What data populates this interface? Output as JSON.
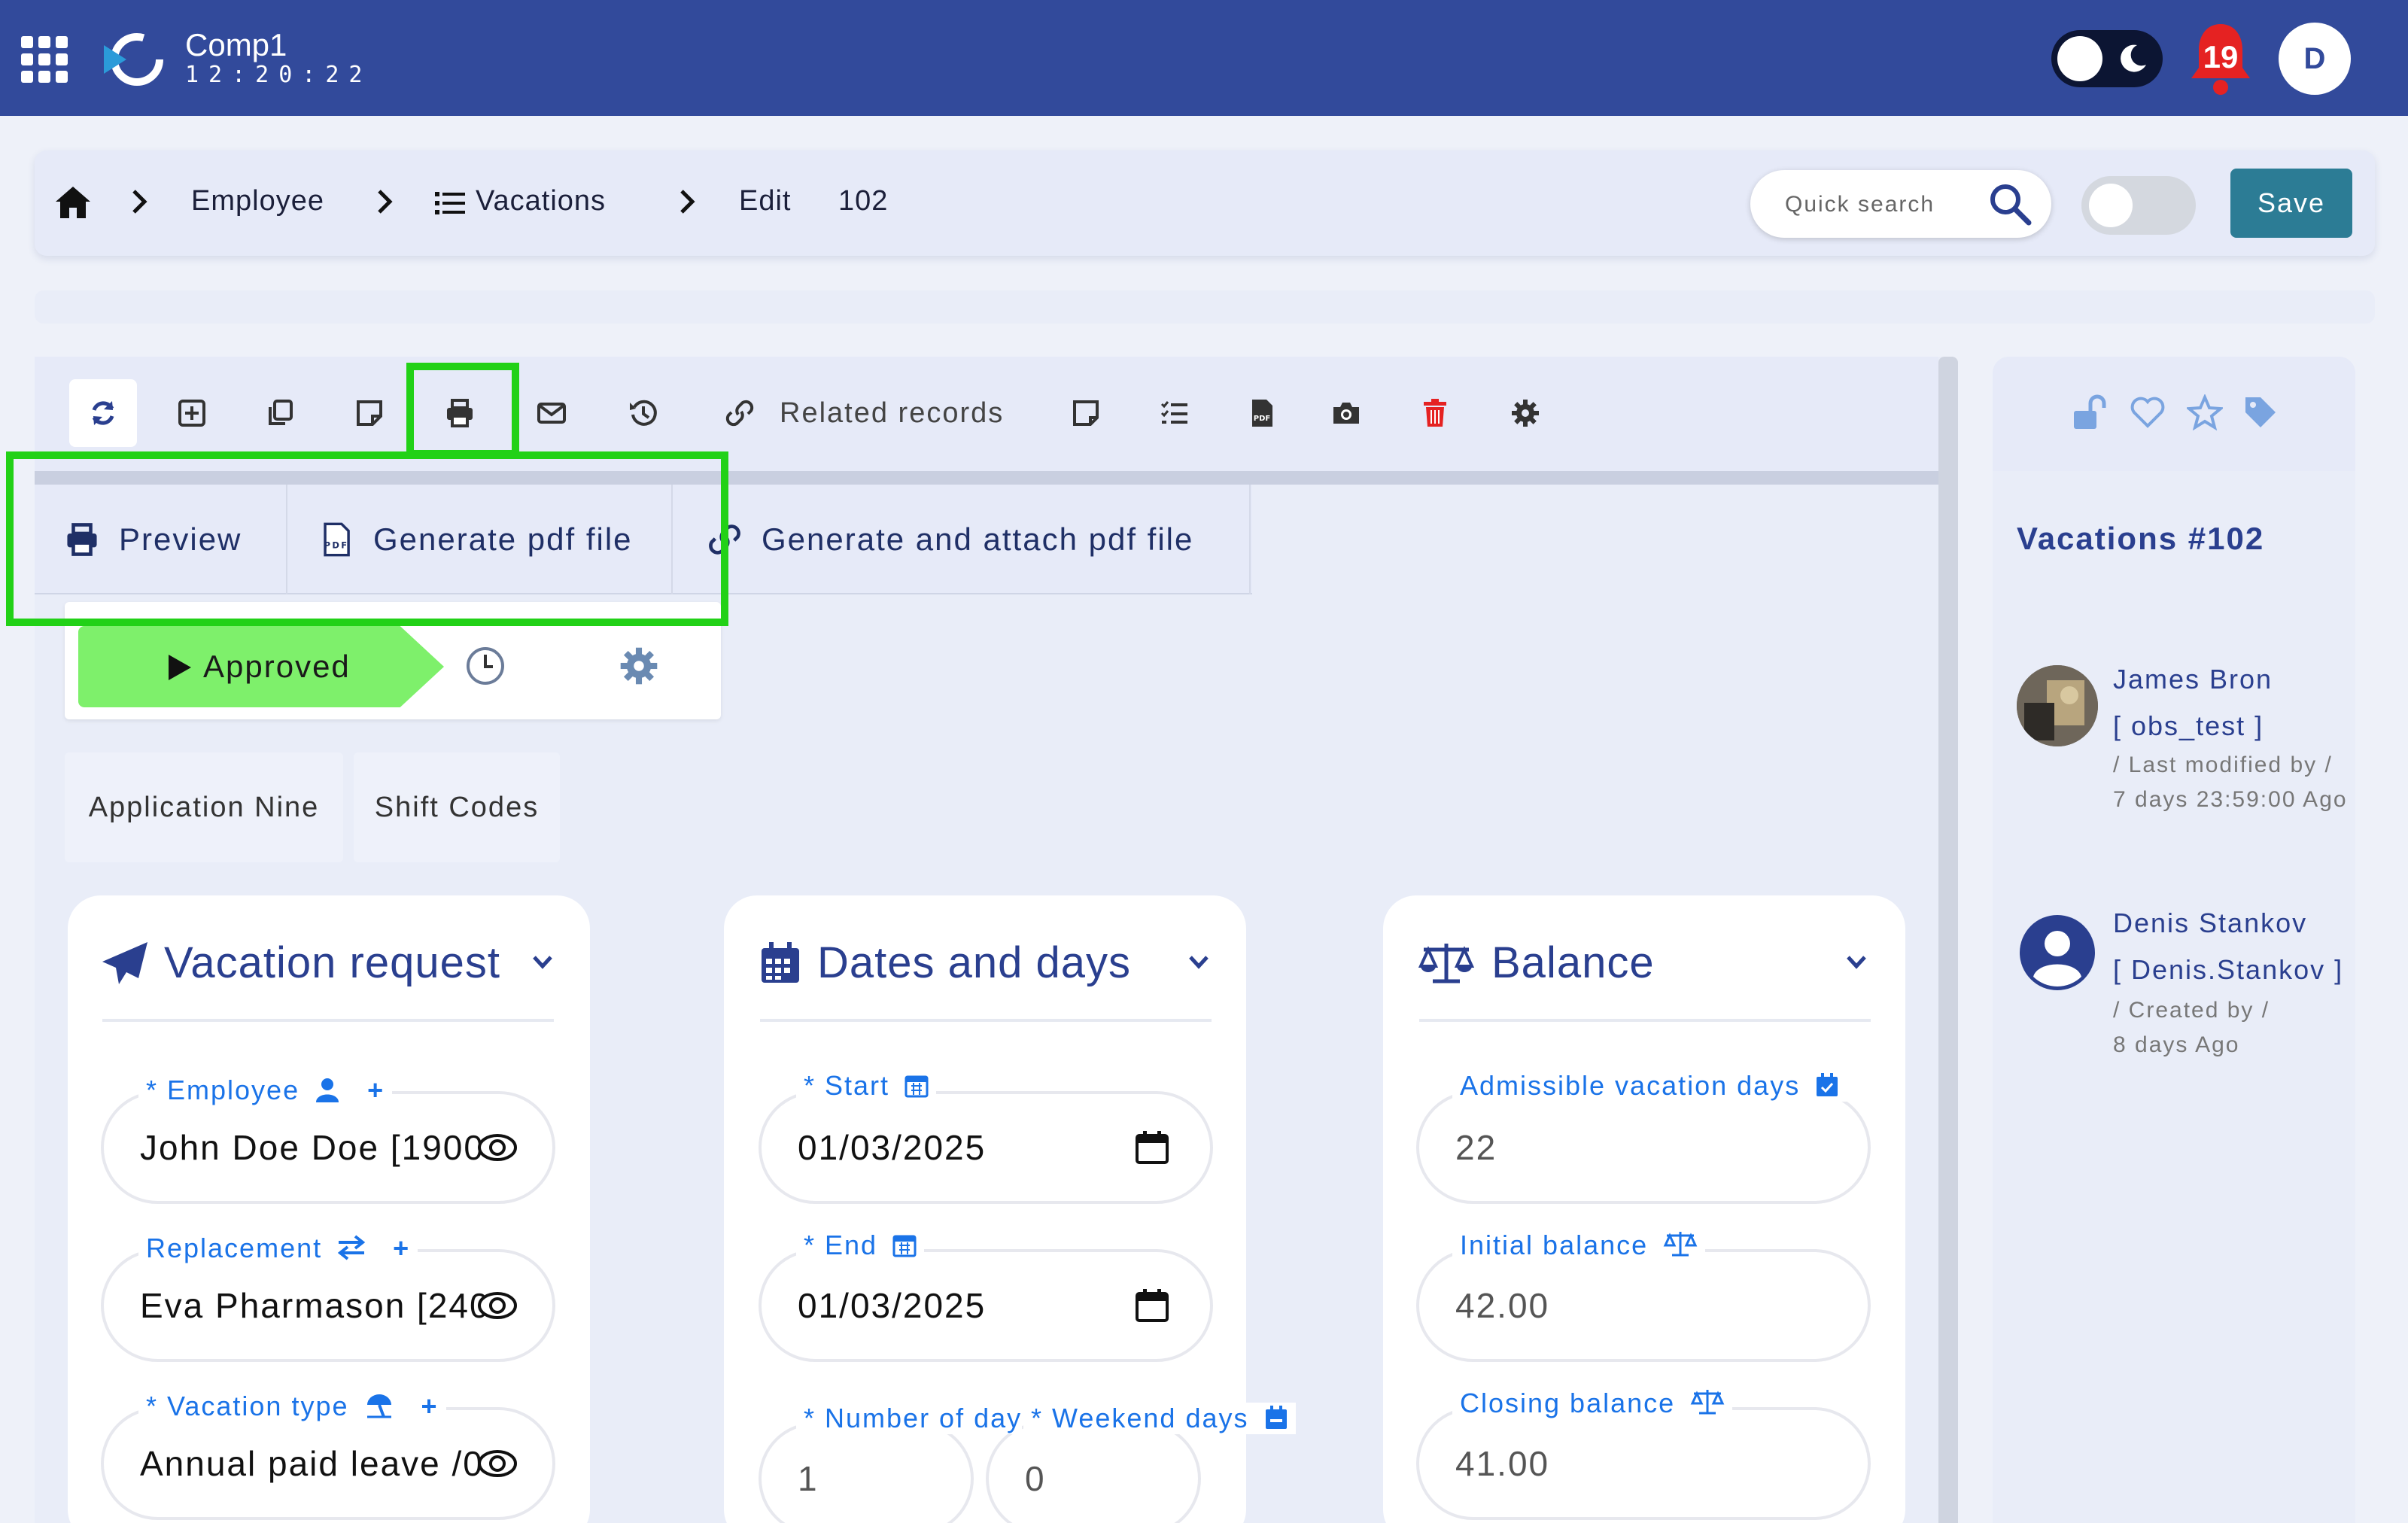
{
  "header": {
    "company": "Comp1",
    "clock": "12:20:22",
    "notifications": "19",
    "avatar_initial": "D"
  },
  "breadcrumb": {
    "employee": "Employee",
    "vacations": "Vacations",
    "edit": "Edit",
    "record_id": "102"
  },
  "search": {
    "placeholder": "Quick search"
  },
  "actions": {
    "save": "Save"
  },
  "toolbar": {
    "related_records": "Related records"
  },
  "print_menu": {
    "preview": "Preview",
    "generate_pdf": "Generate pdf file",
    "generate_attach": "Generate and attach pdf file"
  },
  "status": {
    "current": "Approved"
  },
  "tabs": [
    "Application Nine",
    "Shift Codes"
  ],
  "cards": {
    "vacation_request": {
      "title": "Vacation request",
      "employee_label": "* Employee",
      "employee_value": "John Doe Doe [1900",
      "replacement_label": "Replacement",
      "replacement_value": "Eva Pharmason [240",
      "vacation_type_label": "* Vacation type",
      "vacation_type_value": "Annual paid leave /0"
    },
    "dates": {
      "title": "Dates and days",
      "start_label": "* Start",
      "start_value": "01/03/2025",
      "end_label": "* End",
      "end_value": "01/03/2025",
      "number_days_label": "* Number of day",
      "number_days_value": "1",
      "weekend_label": "* Weekend days",
      "weekend_value": "0"
    },
    "balance": {
      "title": "Balance",
      "admissible_label": "Admissible vacation days",
      "admissible_value": "22",
      "initial_label": "Initial balance",
      "initial_value": "42.00",
      "closing_label": "Closing balance",
      "closing_value": "41.00"
    }
  },
  "record_panel": {
    "title": "Vacations #102",
    "modified_by_name": "James Bron",
    "modified_by_user": "[ obs_test ]",
    "modified_caption": "/ Last modified by /",
    "modified_ago": "7 days 23:59:00 Ago",
    "created_by_name": "Denis Stankov",
    "created_by_user": "[ Denis.Stankov ]",
    "created_caption": "/ Created by /",
    "created_ago": "8 days Ago"
  },
  "colors": {
    "header_bg": "#324a9b",
    "approved": "#7ef06b",
    "highlight": "#22d117",
    "save_button": "#2c7c95",
    "label_blue": "#1a73e8",
    "notification_red": "#e52222"
  }
}
